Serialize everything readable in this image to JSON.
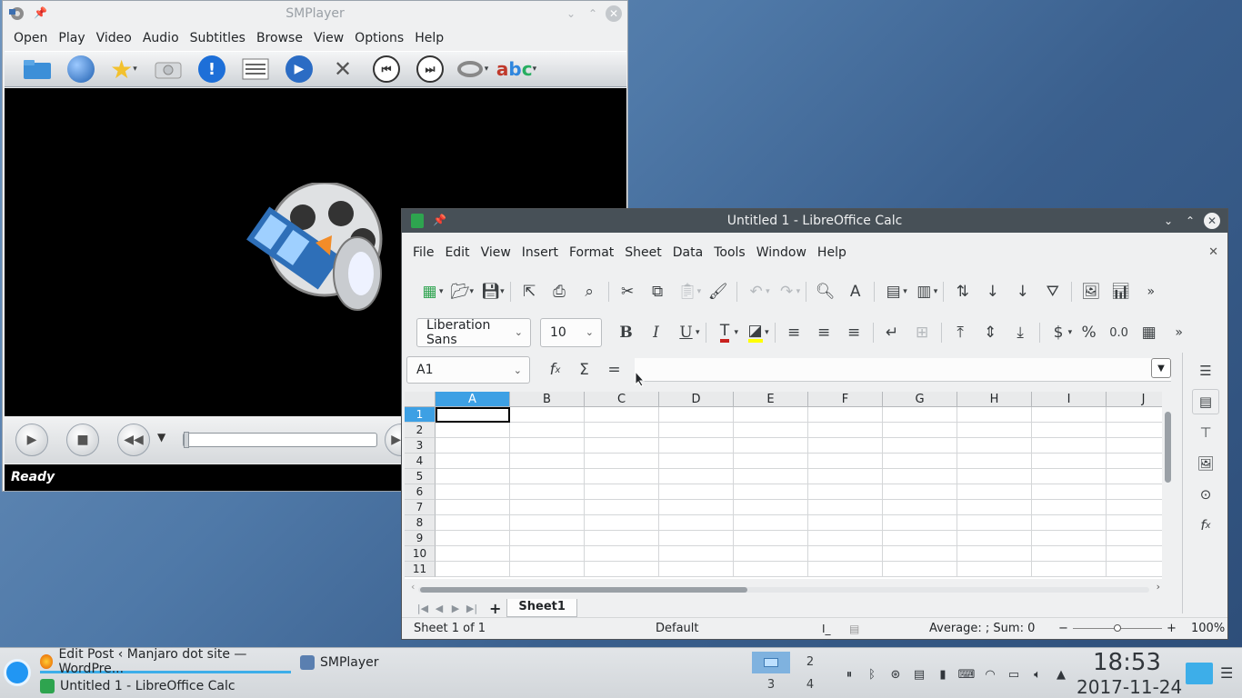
{
  "smplayer": {
    "title": "SMPlayer",
    "menu": [
      "Open",
      "Play",
      "Video",
      "Audio",
      "Subtitles",
      "Browse",
      "View",
      "Options",
      "Help"
    ],
    "status": "Ready"
  },
  "calc": {
    "title": "Untitled 1 - LibreOffice Calc",
    "menu": [
      "File",
      "Edit",
      "View",
      "Insert",
      "Format",
      "Sheet",
      "Data",
      "Tools",
      "Window",
      "Help"
    ],
    "font_name": "Liberation Sans",
    "font_size": "10",
    "name_box": "A1",
    "formula_glyphs": {
      "function_wizard": "f",
      "sum": "Σ",
      "equals": "="
    },
    "columns": [
      "A",
      "B",
      "C",
      "D",
      "E",
      "F",
      "G",
      "H",
      "I",
      "J"
    ],
    "rows": [
      "1",
      "2",
      "3",
      "4",
      "5",
      "6",
      "7",
      "8",
      "9",
      "10",
      "11"
    ],
    "active_cell": "A1",
    "sheet_tab": "Sheet1",
    "status": {
      "sheet": "Sheet 1 of 1",
      "page_style": "Default",
      "selection_summary": "Average: ; Sum: 0",
      "zoom_minus": "−",
      "zoom_plus": "+",
      "zoom": "100%"
    }
  },
  "taskbar": {
    "tasks": [
      {
        "label": "Edit Post ‹ Manjaro dot site — WordPre...",
        "icon": "firefox-icon"
      },
      {
        "label": "SMPlayer",
        "icon": "smplayer-icon"
      },
      {
        "label": "Untitled 1 - LibreOffice Calc",
        "icon": "calc-icon"
      }
    ],
    "desktops": [
      "2",
      "3",
      "4"
    ],
    "clock_time": "18:53",
    "clock_date": "2017-11-24"
  },
  "colors": {
    "calc_titlebar": "#475057",
    "selection": "#3da0e4",
    "desktop": "#4f79a8"
  }
}
